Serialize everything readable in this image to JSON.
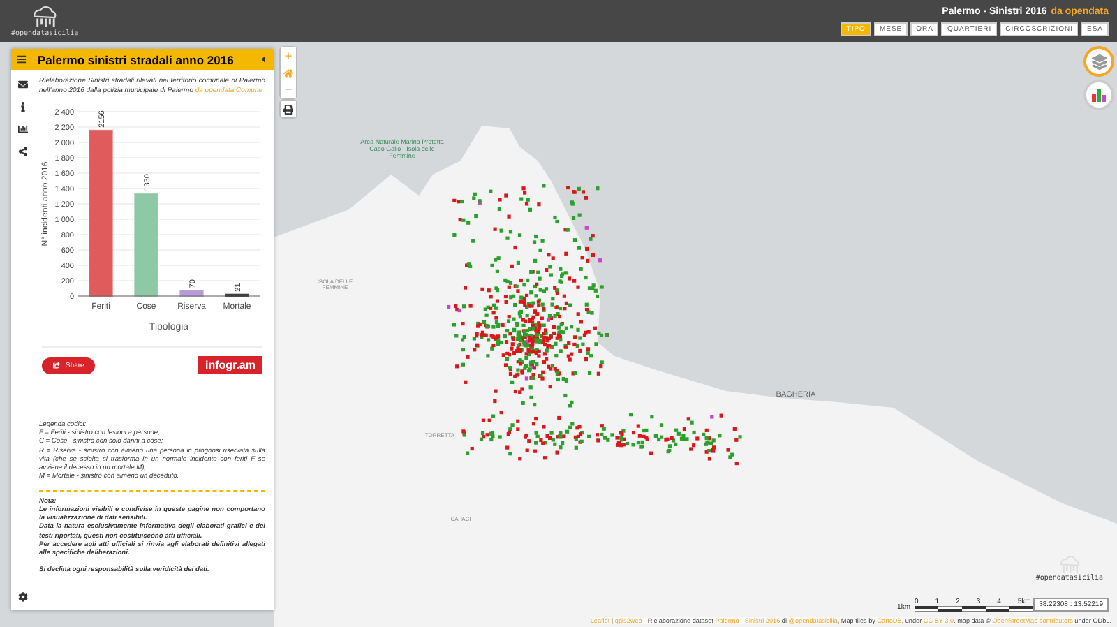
{
  "header": {
    "logo_text": "#opendatasicilia",
    "title": "Palermo - Sinistri 2016",
    "title_link": "da opendata",
    "filters": [
      {
        "label": "TIPO",
        "selected": true
      },
      {
        "label": "MESE",
        "selected": false
      },
      {
        "label": "ORA",
        "selected": false
      },
      {
        "label": "QUARTIERI",
        "selected": false
      },
      {
        "label": "CIRCOSCRIZIONI",
        "selected": false
      },
      {
        "label": "ESA",
        "selected": false
      }
    ]
  },
  "panel": {
    "title": "Palermo sinistri stradali anno 2016",
    "description": [
      {
        "text": "Rielaborazione Sinistri stradali rilevati nel territorio comunale di Palermo nell'anno 2016 dalla polizia municipale di Palermo ",
        "link": false
      },
      {
        "text": "da opendata Comune",
        "link": true
      }
    ],
    "chart_data": {
      "type": "bar",
      "xlabel": "Tipologia",
      "ylabel": "N° incidenti anno 2016",
      "categories": [
        "Feriti",
        "Cose",
        "Riserva",
        "Mortale"
      ],
      "values": [
        2156,
        1330,
        70,
        21
      ],
      "grid": true,
      "colors": [
        "#e05c5c",
        "#8cc9a4",
        "#b79ad8",
        "#222222"
      ],
      "ylim": [
        0,
        2400
      ],
      "yticks": [
        {
          "value": 0,
          "label": "0"
        },
        {
          "value": 200,
          "label": "200"
        },
        {
          "value": 400,
          "label": "400"
        },
        {
          "value": 600,
          "label": "600"
        },
        {
          "value": 800,
          "label": "800"
        },
        {
          "value": 1000,
          "label": "1 000"
        },
        {
          "value": 1200,
          "label": "1 200"
        },
        {
          "value": 1400,
          "label": "1 400"
        },
        {
          "value": 1600,
          "label": "1 600"
        },
        {
          "value": 1800,
          "label": "1 800"
        },
        {
          "value": 2000,
          "label": "2 000"
        },
        {
          "value": 2200,
          "label": "2 200"
        },
        {
          "value": 2400,
          "label": "2 400"
        }
      ],
      "data_labels": true
    },
    "share_label": "Share",
    "brand": "infogr.am",
    "legend": [
      "Legenda codici:",
      "F = Feriti - sinistro con lesioni a persone;",
      "C = Cose - sinistro con solo danni a cose;",
      "R = Riserva - sinistro con almeno una persona in prognosi riservata sulla vita (che se sciolta si trasforma in un normale incidente con feriti F se avviene il decesso in un mortale M);",
      "M = Mortale - sinistro con almeno un deceduto."
    ],
    "notes": [
      "Nota:",
      "Le informazioni visibili e condivise in queste pagine non comportano la visualizzazione di dati sensibili.",
      "Data la natura esclusivamente informativa degli elaborati grafici e dei testi riportati, questi non costituiscono atti ufficiali.",
      "Per accedere agli atti ufficiali si rinvia agli elaborati definitivi allegati alle specifiche deliberazioni.",
      "Si declina ogni responsabilità sulla veridicità dei dati."
    ]
  },
  "map": {
    "labels": [
      {
        "text": "Area Naturale Marina Protetta Capo Gallo - Isola delle Femmine",
        "kind": "park"
      },
      {
        "text": "ISOLA DELLE FEMMINE",
        "kind": "place"
      },
      {
        "text": "TORRETTA",
        "kind": "place"
      },
      {
        "text": "CAPACI",
        "kind": "place"
      },
      {
        "text": "BAGHERIA",
        "kind": "town"
      }
    ],
    "controls": {
      "zoom_in": "+",
      "zoom_out": "−"
    },
    "watermark": "#opendatasicilia",
    "scale": {
      "unit": "1km",
      "ticks": [
        "0",
        "1",
        "2",
        "3",
        "4",
        "5km"
      ]
    },
    "coordinates": "38.22308 : 13.52219",
    "attribution": [
      {
        "text": "Leaflet",
        "link": true
      },
      {
        "text": " | ",
        "link": false
      },
      {
        "text": "qgis2web",
        "link": true
      },
      {
        "text": " - Rielaborazione dataset ",
        "link": false
      },
      {
        "text": "Palermo - Sinistri 2016",
        "link": true
      },
      {
        "text": " di ",
        "link": false
      },
      {
        "text": "@opendatasicilia",
        "link": true
      },
      {
        "text": ", Map tiles by ",
        "link": false
      },
      {
        "text": "CartoDB",
        "link": true
      },
      {
        "text": ", under ",
        "link": false
      },
      {
        "text": "CC BY 3.0",
        "link": true
      },
      {
        "text": ". map data © ",
        "link": false
      },
      {
        "text": "OpenStreetMap contributors",
        "link": true
      },
      {
        "text": " under ODbL.",
        "link": false
      }
    ]
  }
}
